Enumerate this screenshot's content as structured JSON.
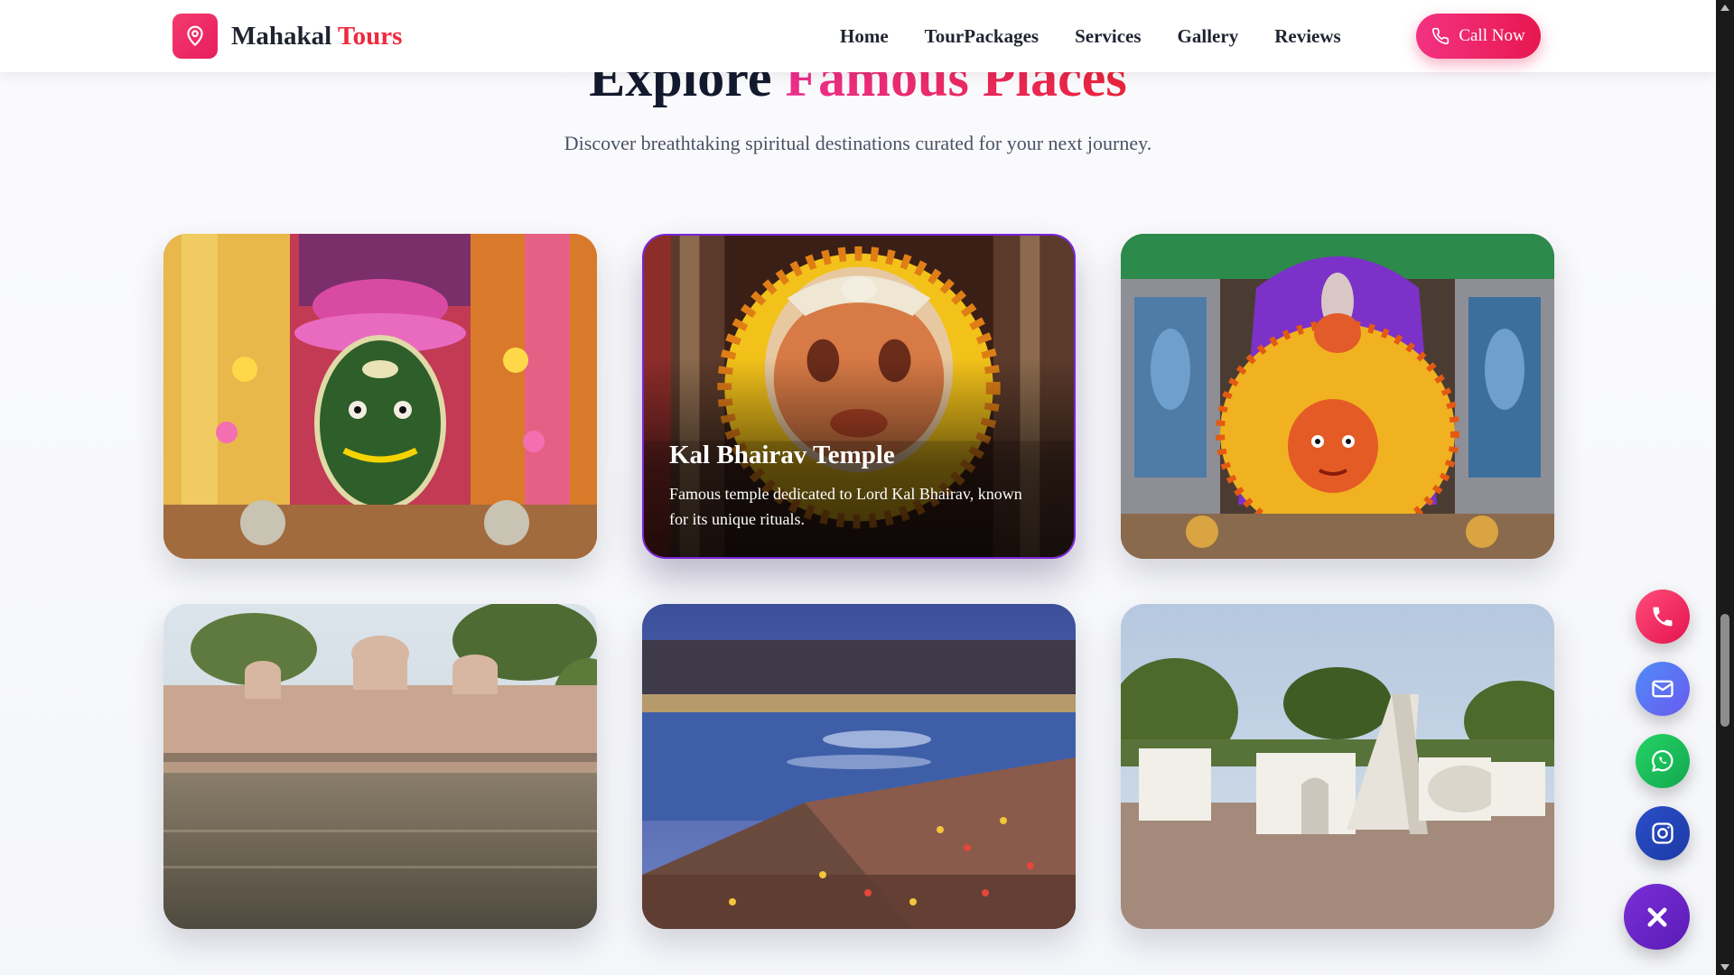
{
  "brand": {
    "name": "Mahakal",
    "accent": "Tours",
    "icon": "map-pin-icon",
    "primary_color": "#e8184f",
    "accent_color": "#ef2a3f"
  },
  "nav": {
    "links": [
      "Home",
      "TourPackages",
      "Services",
      "Gallery",
      "Reviews"
    ],
    "cta": {
      "label": "Call Now",
      "icon": "phone-icon"
    }
  },
  "section": {
    "title_plain": "Explore ",
    "title_accent": "Famous Places",
    "subtitle": "Discover breathtaking spiritual destinations curated for your next journey."
  },
  "cards": [
    {
      "icon": "idol-shiva-photo",
      "title": "",
      "description": "",
      "active": false
    },
    {
      "icon": "idol-kal-bhairav-photo",
      "title": "Kal Bhairav Temple",
      "description": "Famous temple dedicated to Lord Kal Bhairav, known for its unique rituals.",
      "active": true
    },
    {
      "icon": "idol-goddess-photo",
      "title": "",
      "description": "",
      "active": false
    },
    {
      "icon": "river-ghat-photo",
      "title": "",
      "description": "",
      "active": false
    },
    {
      "icon": "crowd-ghat-photo",
      "title": "",
      "description": "",
      "active": false
    },
    {
      "icon": "observatory-photo",
      "title": "",
      "description": "",
      "active": false
    }
  ],
  "floating_actions": [
    {
      "icon": "phone-icon",
      "color": "#e5134f"
    },
    {
      "icon": "mail-icon",
      "color": "#5f73f3"
    },
    {
      "icon": "whatsapp-icon",
      "color": "#1ec05c"
    },
    {
      "icon": "instagram-icon",
      "color": "#2444b8"
    },
    {
      "icon": "close-icon",
      "color": "#6a24c6"
    }
  ]
}
